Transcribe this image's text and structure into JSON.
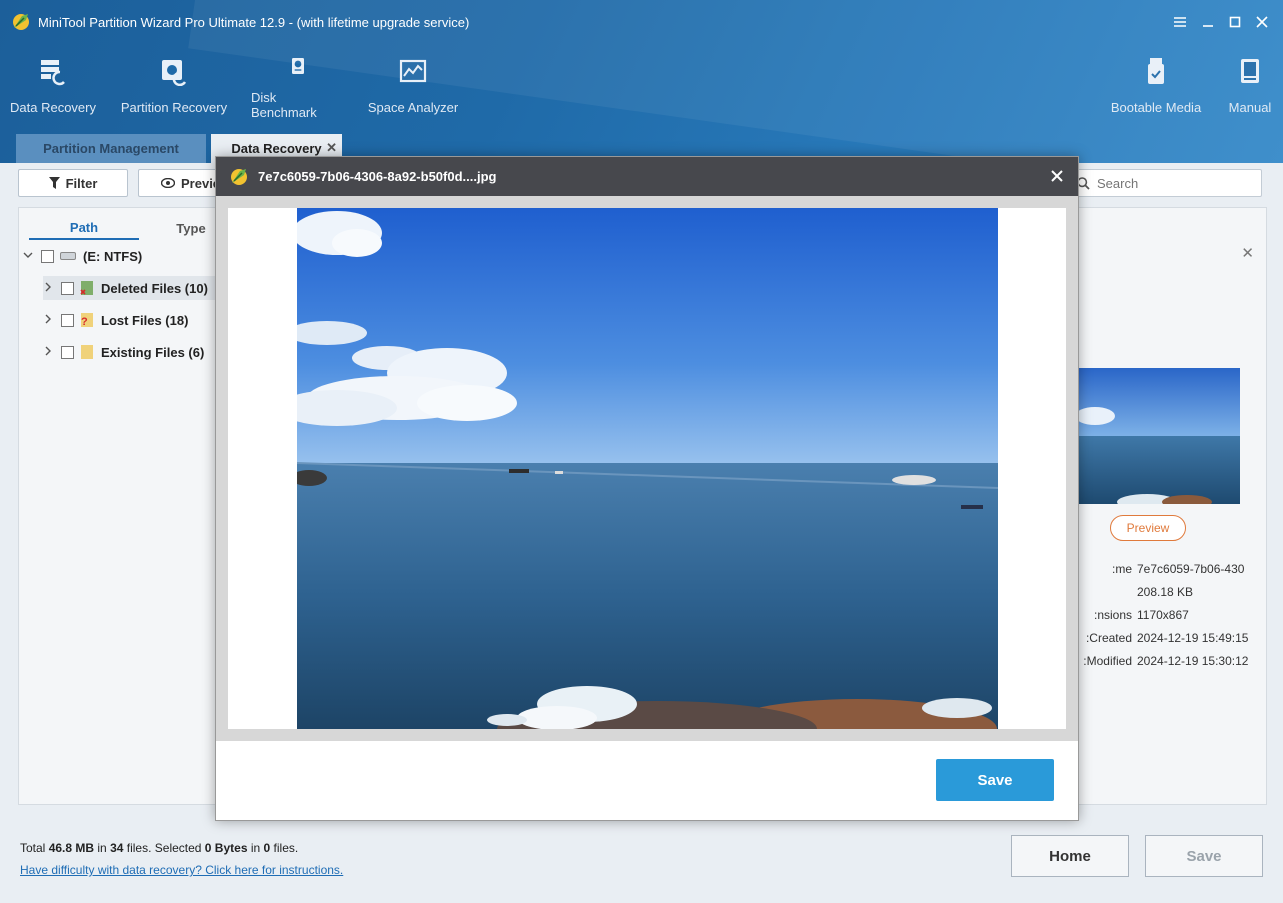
{
  "app": {
    "title": "MiniTool Partition Wizard Pro Ultimate 12.9 - (with lifetime upgrade service)"
  },
  "toolbar": {
    "tools": [
      {
        "label": "Data Recovery",
        "icon": "data-recovery-icon"
      },
      {
        "label": "Partition Recovery",
        "icon": "partition-recovery-icon"
      },
      {
        "label": "Disk Benchmark",
        "icon": "disk-benchmark-icon"
      },
      {
        "label": "Space Analyzer",
        "icon": "space-analyzer-icon"
      }
    ],
    "right_tools": [
      {
        "label": "Bootable Media",
        "icon": "bootable-media-icon"
      },
      {
        "label": "Manual",
        "icon": "manual-icon"
      }
    ]
  },
  "tabs": {
    "partition_management": "Partition Management",
    "data_recovery": "Data Recovery"
  },
  "actions": {
    "filter": "Filter",
    "preview": "Previe",
    "search_placeholder": "Search"
  },
  "left_panel": {
    "tab_path": "Path",
    "tab_type": "Type",
    "drive": "(E: NTFS)",
    "items": [
      {
        "label": "Deleted Files (10)"
      },
      {
        "label": "Lost Files (18)"
      },
      {
        "label": "Existing Files (6)"
      }
    ]
  },
  "right_panel": {
    "preview_label": "Preview",
    "info": [
      {
        "label": "me:",
        "value": "7e7c6059-7b06-430"
      },
      {
        "label": "",
        "value": "208.18 KB"
      },
      {
        "label": "nsions:",
        "value": "1170x867"
      },
      {
        "label": "Created:",
        "value": "2024-12-19 15:49:15"
      },
      {
        "label": "Modified:",
        "value": "2024-12-19 15:30:12"
      }
    ]
  },
  "bottom": {
    "total_prefix": "Total ",
    "total_size": "46.8 MB",
    "in1": " in ",
    "total_files": "34",
    "files_selected": " files.  Selected ",
    "selected_size": "0 Bytes",
    "in2": " in ",
    "selected_files": "0",
    "files_end": " files.",
    "help_link": "Have difficulty with data recovery? Click here for instructions.",
    "home": "Home",
    "save": "Save"
  },
  "dialog": {
    "file_name": "7e7c6059-7b06-4306-8a92-b50f0d....jpg",
    "save": "Save"
  },
  "colors": {
    "header_blue": "#1f6aa8",
    "accent_blue": "#2a9ad9",
    "preview_orange": "#e07a3c"
  }
}
